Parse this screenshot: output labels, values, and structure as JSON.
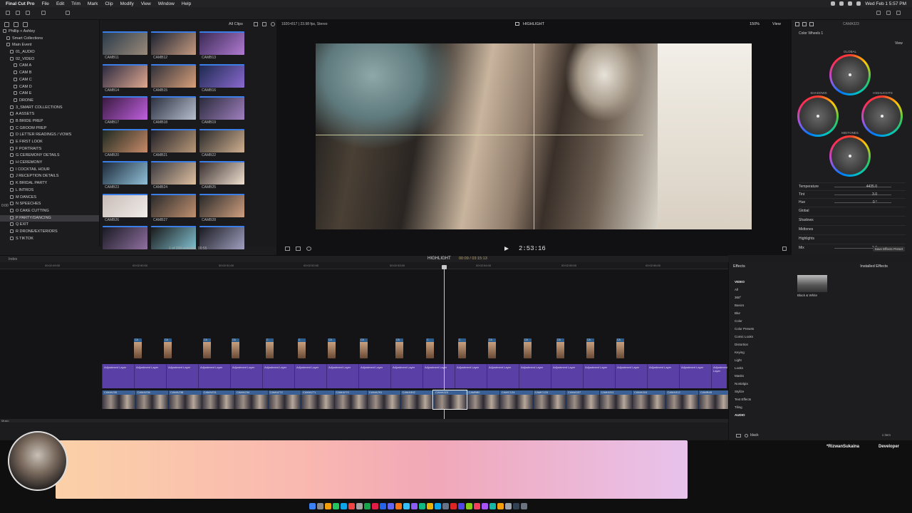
{
  "menubar": {
    "app": "Final Cut Pro",
    "items": [
      "File",
      "Edit",
      "Trim",
      "Mark",
      "Clip",
      "Modify",
      "View",
      "Window",
      "Help"
    ],
    "clock": "Wed Feb 1  5:57 PM"
  },
  "library": {
    "rows": [
      {
        "label": "Phillip + Ashley",
        "indent": 0,
        "sel": false
      },
      {
        "label": "Smart Collections",
        "indent": 1,
        "sel": false
      },
      {
        "label": "Main Event",
        "indent": 1,
        "sel": false
      },
      {
        "label": "01_AUDIO",
        "indent": 2,
        "sel": false
      },
      {
        "label": "02_VIDEO",
        "indent": 2,
        "sel": false
      },
      {
        "label": "CAM A",
        "indent": 3,
        "sel": false
      },
      {
        "label": "CAM B",
        "indent": 3,
        "sel": false
      },
      {
        "label": "CAM C",
        "indent": 3,
        "sel": false
      },
      {
        "label": "CAM D",
        "indent": 3,
        "sel": false
      },
      {
        "label": "CAM E",
        "indent": 3,
        "sel": false
      },
      {
        "label": "DRONE",
        "indent": 3,
        "sel": false
      },
      {
        "label": "3_SMART COLLECTIONS",
        "indent": 2,
        "sel": false
      },
      {
        "label": "A ASSETS",
        "indent": 2,
        "sel": false
      },
      {
        "label": "B BRIDE PREP",
        "indent": 2,
        "sel": false
      },
      {
        "label": "C GROOM PREP",
        "indent": 2,
        "sel": false
      },
      {
        "label": "D LETTER READINGS / VOWS",
        "indent": 2,
        "sel": false
      },
      {
        "label": "E FIRST LOOK",
        "indent": 2,
        "sel": false
      },
      {
        "label": "F PORTRAITS",
        "indent": 2,
        "sel": false
      },
      {
        "label": "G CEREMONY DETAILS",
        "indent": 2,
        "sel": false
      },
      {
        "label": "H CEREMONY",
        "indent": 2,
        "sel": false
      },
      {
        "label": "I COCKTAIL HOUR",
        "indent": 2,
        "sel": false
      },
      {
        "label": "J RECEPTION DETAILS",
        "indent": 2,
        "sel": false
      },
      {
        "label": "K BRIDAL PARTY",
        "indent": 2,
        "sel": false
      },
      {
        "label": "L INTROS",
        "indent": 2,
        "sel": false
      },
      {
        "label": "M DANCES",
        "indent": 2,
        "sel": false
      },
      {
        "label": "N SPEECHES",
        "indent": 2,
        "sel": false
      },
      {
        "label": "O CAKE CUTTING",
        "indent": 2,
        "sel": false
      },
      {
        "label": "P PARTY/DANCING",
        "indent": 2,
        "sel": true
      },
      {
        "label": "Q EXIT",
        "indent": 2,
        "sel": false
      },
      {
        "label": "R DRONE/EXTERIORS",
        "indent": 2,
        "sel": false
      },
      {
        "label": "S TIKTOK",
        "indent": 2,
        "sel": false
      }
    ],
    "side_timecode": "0:00"
  },
  "browser": {
    "filter": "All Clips",
    "clips": [
      "CAMB11",
      "CAMB12",
      "CAMB13",
      "CAMB14",
      "CAMB15",
      "CAMB16",
      "CAMB17",
      "CAMB18",
      "CAMB19",
      "CAMB20",
      "CAMB21",
      "CAMB22",
      "CAMB23",
      "CAMB24",
      "CAMB25",
      "CAMB26",
      "CAMB27",
      "CAMB28",
      "",
      "",
      ""
    ],
    "status": "1 of 339 selected, 00:55"
  },
  "viewer": {
    "format": "1920×817 | 23.98 fps, Stereo",
    "title": "HIGHLIGHT",
    "zoom": "150%",
    "view": "View",
    "timecode": "2:53:16"
  },
  "inspector": {
    "clip": "CAMA323",
    "effect": "Color Wheels 1",
    "view": "View",
    "wheels": [
      {
        "label": "GLOBAL"
      },
      {
        "label": "SHADOWS"
      },
      {
        "label": "HIGHLIGHTS"
      },
      {
        "label": "MIDTONES"
      }
    ],
    "rows": [
      {
        "label": "Temperature",
        "value": "4435.0"
      },
      {
        "label": "Tint",
        "value": "3.0"
      },
      {
        "label": "Hue",
        "value": "0 °"
      },
      {
        "label": "Global",
        "value": ""
      },
      {
        "label": "Shadows",
        "value": ""
      },
      {
        "label": "Midtones",
        "value": ""
      },
      {
        "label": "Highlights",
        "value": ""
      },
      {
        "label": "Mix",
        "value": "1.0"
      }
    ],
    "save": "Save Effects Preset"
  },
  "timeline": {
    "index": "Index",
    "project": "HIGHLIGHT",
    "duration": "00:09 / 03:15:13",
    "ruler": [
      "00:02:49:00",
      "00:02:50:00",
      "00:02:51:00",
      "00:02:52:00",
      "00:02:53:00",
      "00:02:54:00",
      "00:02:55:00",
      "00:02:56:00"
    ],
    "adjustment": "Adjustment Layer",
    "connected": [
      "CA",
      "CA",
      "CA",
      "CA",
      "C",
      "C",
      "CA",
      "CA",
      "CA",
      "C",
      "C",
      "CA",
      "CA",
      "CA",
      "CA",
      "CA"
    ],
    "primary": [
      "CAMA230",
      "CAMA236",
      "CAMA238",
      "CAMA231",
      "CAMA234",
      "CAMA272",
      "CAMA271",
      "CAMA270",
      "CAMA291",
      "CAMA302",
      "CAMA323",
      "CAMB80",
      "CAMC124",
      "CAMC120",
      "CAMA337",
      "CAMA311",
      "CAMA310",
      "CAMA312",
      "CAMB45",
      ""
    ],
    "music": "Music"
  },
  "effects": {
    "title": "Effects",
    "installed": "Installed Effects",
    "categories": [
      {
        "label": "VIDEO",
        "bold": true
      },
      {
        "label": "All",
        "bold": false
      },
      {
        "label": "360°",
        "bold": false
      },
      {
        "label": "Basics",
        "bold": false
      },
      {
        "label": "Blur",
        "bold": false
      },
      {
        "label": "Color",
        "bold": false
      },
      {
        "label": "Color Presets",
        "bold": false
      },
      {
        "label": "Comic Looks",
        "bold": false
      },
      {
        "label": "Distortion",
        "bold": false
      },
      {
        "label": "Keying",
        "bold": false
      },
      {
        "label": "Light",
        "bold": false
      },
      {
        "label": "Looks",
        "bold": false
      },
      {
        "label": "Masks",
        "bold": false
      },
      {
        "label": "Nostalgia",
        "bold": false
      },
      {
        "label": "Stylize",
        "bold": false
      },
      {
        "label": "Text Effects",
        "bold": false
      },
      {
        "label": "Tiling",
        "bold": false
      },
      {
        "label": "AUDIO",
        "bold": true
      }
    ],
    "result": "Black & White",
    "search": "black",
    "count": "1 item"
  },
  "overlay": {
    "name": "*RizwanSukaina",
    "role": "Developer"
  }
}
